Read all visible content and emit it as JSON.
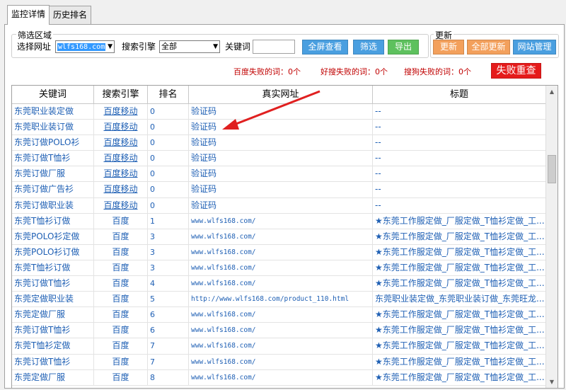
{
  "tabs": [
    {
      "label": "监控详情",
      "active": true
    },
    {
      "label": "历史排名",
      "active": false
    }
  ],
  "filter": {
    "legend": "筛选区域",
    "site_label": "选择网址",
    "site_value": "wlfs168.com",
    "engine_label": "搜索引擎",
    "engine_value": "全部",
    "keyword_label": "关键词",
    "keyword_value": "",
    "fullscreen_btn": "全屏查看",
    "filter_btn": "筛选",
    "export_btn": "导出"
  },
  "update": {
    "legend": "更新",
    "refresh_btn": "更新",
    "refresh_all_btn": "全部更新",
    "site_manage_btn": "网站管理"
  },
  "fails": {
    "baidu": "百度失败的词：0个",
    "haosou": "好搜失败的词：0个",
    "sogou": "搜狗失败的词：0个",
    "retry_btn": "失败重查"
  },
  "grid": {
    "headers": [
      "关键词",
      "搜索引擎",
      "排名",
      "真实网址",
      "标题"
    ],
    "rows": [
      {
        "kw": "东莞职业装定做",
        "eng": "百度移动",
        "rank": "0",
        "url": "验证码",
        "title": "--"
      },
      {
        "kw": "东莞职业装订做",
        "eng": "百度移动",
        "rank": "0",
        "url": "验证码",
        "title": "--"
      },
      {
        "kw": "东莞订做POLO衫",
        "eng": "百度移动",
        "rank": "0",
        "url": "验证码",
        "title": "--"
      },
      {
        "kw": "东莞订做T恤衫",
        "eng": "百度移动",
        "rank": "0",
        "url": "验证码",
        "title": "--"
      },
      {
        "kw": "东莞订做厂服",
        "eng": "百度移动",
        "rank": "0",
        "url": "验证码",
        "title": "--"
      },
      {
        "kw": "东莞订做广告衫",
        "eng": "百度移动",
        "rank": "0",
        "url": "验证码",
        "title": "--"
      },
      {
        "kw": "东莞订做职业装",
        "eng": "百度移动",
        "rank": "0",
        "url": "验证码",
        "title": "--"
      },
      {
        "kw": "东莞T恤衫订做",
        "eng": "百度",
        "rank": "1",
        "url": "www.wlfs168.com/",
        "title": "★东莞工作服定做_厂服定做_T恤衫定做_工..."
      },
      {
        "kw": "东莞POLO衫定做",
        "eng": "百度",
        "rank": "3",
        "url": "www.wlfs168.com/",
        "title": "★东莞工作服定做_厂服定做_T恤衫定做_工..."
      },
      {
        "kw": "东莞POLO衫订做",
        "eng": "百度",
        "rank": "3",
        "url": "www.wlfs168.com/",
        "title": "★东莞工作服定做_厂服定做_T恤衫定做_工..."
      },
      {
        "kw": "东莞T恤衫订做",
        "eng": "百度",
        "rank": "3",
        "url": "www.wlfs168.com/",
        "title": "★东莞工作服定做_厂服定做_T恤衫定做_工..."
      },
      {
        "kw": "东莞订做T恤衫",
        "eng": "百度",
        "rank": "4",
        "url": "www.wlfs168.com/",
        "title": "★东莞工作服定做_厂服定做_T恤衫定做_工..."
      },
      {
        "kw": "东莞定做职业装",
        "eng": "百度",
        "rank": "5",
        "url": "http://www.wlfs168.com/product_110.html",
        "title": "东莞职业装定做_东莞职业装订做_东莞旺龙..."
      },
      {
        "kw": "东莞定做厂服",
        "eng": "百度",
        "rank": "6",
        "url": "www.wlfs168.com/",
        "title": "★东莞工作服定做_厂服定做_T恤衫定做_工..."
      },
      {
        "kw": "东莞订做T恤衫",
        "eng": "百度",
        "rank": "6",
        "url": "www.wlfs168.com/",
        "title": "★东莞工作服定做_厂服定做_T恤衫定做_工..."
      },
      {
        "kw": "东莞T恤衫定做",
        "eng": "百度",
        "rank": "7",
        "url": "www.wlfs168.com/",
        "title": "★东莞工作服定做_厂服定做_T恤衫定做_工..."
      },
      {
        "kw": "东莞订做T恤衫",
        "eng": "百度",
        "rank": "7",
        "url": "www.wlfs168.com/",
        "title": "★东莞工作服定做_厂服定做_T恤衫定做_工..."
      },
      {
        "kw": "东莞定做厂服",
        "eng": "百度",
        "rank": "8",
        "url": "www.wlfs168.com/",
        "title": "★东莞工作服定做_厂服定做_T恤衫定做_工..."
      }
    ]
  },
  "colors": {
    "link": "#1e5fb4",
    "fail_text": "#c00000",
    "arrow": "#e02020",
    "retry": "#e51b1b"
  },
  "icons": {
    "dropdown": "chevron-down-icon",
    "annotation": "red-arrow-icon"
  }
}
